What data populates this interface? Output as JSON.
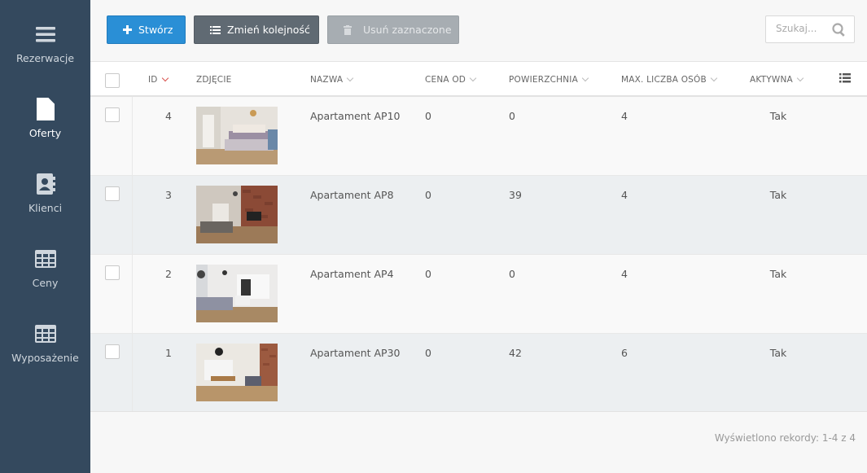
{
  "sidebar": {
    "items": [
      {
        "label": "Rezerwacje",
        "icon": "menu-icon"
      },
      {
        "label": "Oferty",
        "icon": "document-icon",
        "active": true
      },
      {
        "label": "Klienci",
        "icon": "contact-book-icon"
      },
      {
        "label": "Ceny",
        "icon": "table-icon"
      },
      {
        "label": "Wyposażenie",
        "icon": "table-icon"
      }
    ]
  },
  "toolbar": {
    "create_label": "Stwórz",
    "reorder_label": "Zmień kolejność",
    "delete_label": "Usuń zaznaczone",
    "search_placeholder": "Szukaj..."
  },
  "table": {
    "columns": {
      "id": "ID",
      "photo": "ZDJĘCIE",
      "name": "NAZWA",
      "price_from": "CENA OD",
      "area": "POWIERZCHNIA",
      "max_people": "MAX. LICZBA OSÓB",
      "active": "AKTYWNA"
    },
    "rows": [
      {
        "id": "4",
        "name": "Apartament AP10",
        "price_from": "0",
        "area": "0",
        "max_people": "4",
        "active": "Tak"
      },
      {
        "id": "3",
        "name": "Apartament AP8",
        "price_from": "0",
        "area": "39",
        "max_people": "4",
        "active": "Tak"
      },
      {
        "id": "2",
        "name": "Apartament AP4",
        "price_from": "0",
        "area": "0",
        "max_people": "4",
        "active": "Tak"
      },
      {
        "id": "1",
        "name": "Apartament AP30",
        "price_from": "0",
        "area": "42",
        "max_people": "6",
        "active": "Tak"
      }
    ]
  },
  "footer": {
    "records_info": "Wyświetlono rekordy: 1-4 z 4"
  },
  "colors": {
    "sidebar_bg": "#34495e",
    "primary": "#2a8fd6",
    "secondary": "#606a73",
    "disabled": "#a7adb2",
    "sort_active": "#d9534f"
  }
}
